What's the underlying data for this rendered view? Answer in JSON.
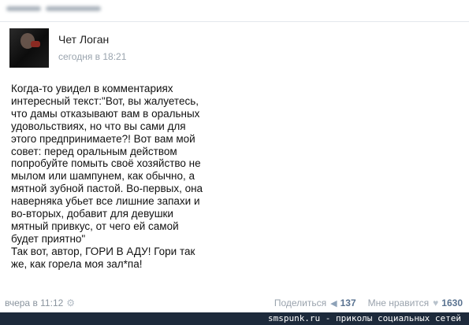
{
  "post": {
    "author": "Чет Логан",
    "time": "сегодня в 18:21",
    "text": "Когда-то увидел в комментариях\nинтересный текст:\"Вот, вы жалуетесь,\nчто дамы отказывают вам в оральных\nудовольствиях, но что вы сами для\nэтого предпринимаете?! Вот вам мой\nсовет: перед оральным действом\nпопробуйте помыть своё хозяйство не\nмылом или шампунем, как обычно, а\nмятной зубной пастой. Во-первых, она\nнаверняка убьет все лишние запахи и\nво-вторых, добавит для девушки\nмятный привкус, от чего ей самой\nбудет приятно\"\nТак вот, автор, ГОРИ В АДУ! Гори так\nже, как горела моя зал*па!"
  },
  "footer": {
    "time": "вчера в 11:12",
    "share_label": "Поделиться",
    "share_count": "137",
    "like_label": "Мне нравится",
    "like_count": "1630"
  },
  "watermark": "smspunk.ru - приколы социальных сетей",
  "icons": {
    "settings": "gear-icon",
    "share": "megaphone-icon",
    "like": "heart-icon"
  },
  "colors": {
    "count_text": "#5a7391",
    "muted_text": "#9aa4ae",
    "watermark_bg": "#1d2a3b"
  }
}
